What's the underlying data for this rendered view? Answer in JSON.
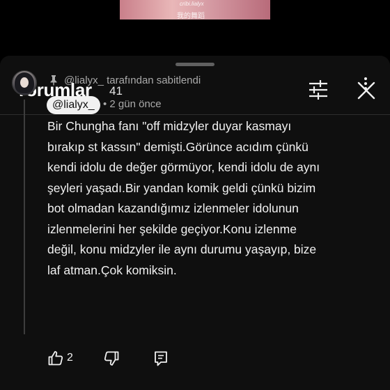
{
  "video": {
    "caption_top": "cribi.lialyx",
    "caption_bottom": "我的舞蹈"
  },
  "header": {
    "title": "Yorumlar",
    "count": "41"
  },
  "comment": {
    "pinned_text": "@lialyx_ tarafından sabitlendi",
    "author": "@lialyx_",
    "time": "• 2 gün önce",
    "lines": [
      "Bir Chungha fanı \"off midzyler duyar kasmayı",
      "bırakıp st kassın\" demişti.Görünce acıdım çünkü",
      "kendi idolu de değer görmüyor, kendi idolu de aynı",
      "şeyleri yaşadı.Bir yandan komik geldi çünkü bizim",
      "bot olmadan kazandığımız izlenmeler idolunun",
      "izlenmelerini her şekilde geçiyor.Konu izlenme",
      "değil, konu midzyler ile aynı durumu yaşayıp, bize",
      "laf atman.Çok komiksin."
    ],
    "like_count": "2"
  },
  "icons": {
    "filter": "sliders-icon",
    "close": "close-icon",
    "pin": "pin-icon",
    "more": "more-vertical-icon",
    "like": "thumbs-up-icon",
    "dislike": "thumbs-down-icon",
    "reply": "reply-icon"
  },
  "colors": {
    "background": "#0f0f0f",
    "text": "#f1f1f1",
    "secondary_text": "#aaaaaa",
    "chip_background": "#f1f1f1"
  }
}
